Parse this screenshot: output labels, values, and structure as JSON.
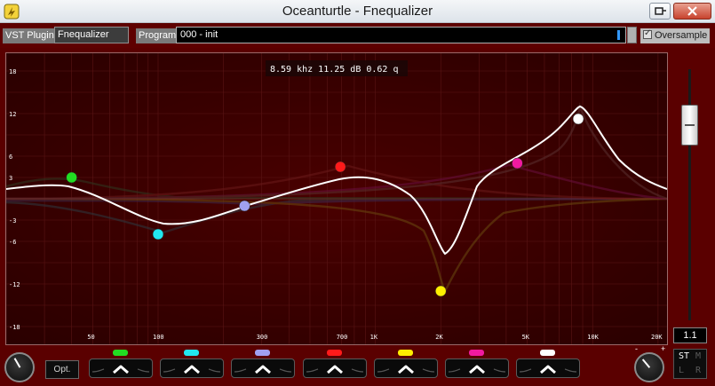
{
  "window": {
    "title": "Oceanturtle - Fnequalizer"
  },
  "toolbar": {
    "vst_label": "VST Plugin:",
    "plugin_name": "Fnequalizer",
    "program_label": "Program:",
    "program_value": "000 - init",
    "oversample_label": "Oversample",
    "oversample_checked": true
  },
  "graph": {
    "readout": "8.59 khz 11.25 dB 0.62 q",
    "db_ticks": [
      "18",
      "12",
      "6",
      "3",
      "-3",
      "-6",
      "-12",
      "-18"
    ],
    "freq_ticks": [
      "50",
      "100",
      "300",
      "700",
      "1K",
      "2K",
      "5K",
      "10K",
      "20K"
    ],
    "nodes": [
      {
        "color": "#22dd22",
        "freq_hz": 40,
        "gain_db": 3
      },
      {
        "color": "#22e8f0",
        "freq_hz": 100,
        "gain_db": -5
      },
      {
        "color": "#a0a0f0",
        "freq_hz": 250,
        "gain_db": -1
      },
      {
        "color": "#ff1a1a",
        "freq_hz": 690,
        "gain_db": 4.5
      },
      {
        "color": "#ffee00",
        "freq_hz": 2000,
        "gain_db": -13
      },
      {
        "color": "#f01aa0",
        "freq_hz": 4500,
        "gain_db": 5
      },
      {
        "color": "#ffffff",
        "freq_hz": 8590,
        "gain_db": 11.25
      }
    ]
  },
  "master": {
    "gain_value": "1.1"
  },
  "bottom": {
    "opt_label": "Opt.",
    "knob_minus": "-",
    "knob_plus": "+",
    "bands": [
      {
        "color": "#22dd22"
      },
      {
        "color": "#22e8f0"
      },
      {
        "color": "#a0a0f0"
      },
      {
        "color": "#ff1a1a"
      },
      {
        "color": "#ffee00"
      },
      {
        "color": "#f01aa0"
      },
      {
        "color": "#ffffff"
      }
    ],
    "mode": {
      "st": "ST",
      "m": "M",
      "l": "L",
      "r": "R"
    }
  }
}
